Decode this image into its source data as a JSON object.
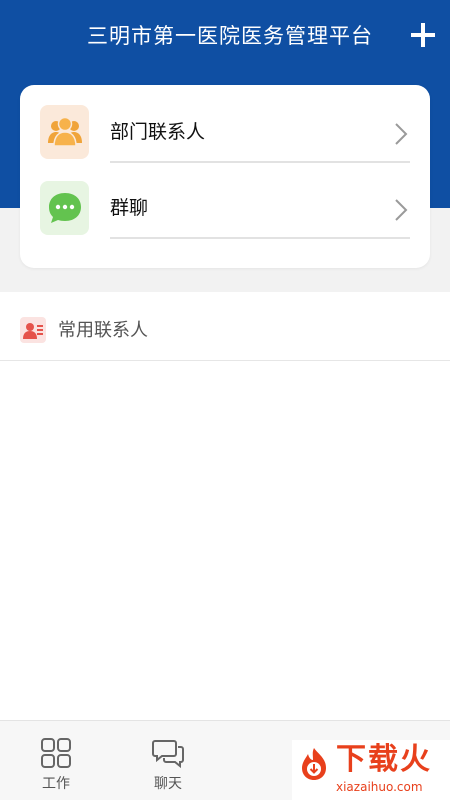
{
  "header": {
    "title": "三明市第一医院医务管理平台",
    "add_icon": "plus-icon"
  },
  "menu": {
    "items": [
      {
        "label": "部门联系人",
        "icon": "department-contacts-icon",
        "icon_color": "#f0a43a",
        "icon_bg": "#fbe9da"
      },
      {
        "label": "群聊",
        "icon": "group-chat-icon",
        "icon_color": "#63c34f",
        "icon_bg": "#e7f5e2"
      }
    ]
  },
  "section": {
    "label": "常用联系人",
    "icon": "contact-card-icon"
  },
  "tabbar": {
    "tabs": [
      {
        "label": "工作",
        "icon": "grid-icon"
      },
      {
        "label": "聊天",
        "icon": "chat-bubbles-icon"
      }
    ]
  },
  "watermark": {
    "text": "下载火",
    "url": "xiazaihuo.com"
  },
  "colors": {
    "brand": "#0f4fa3",
    "watermark": "#e8401c"
  }
}
